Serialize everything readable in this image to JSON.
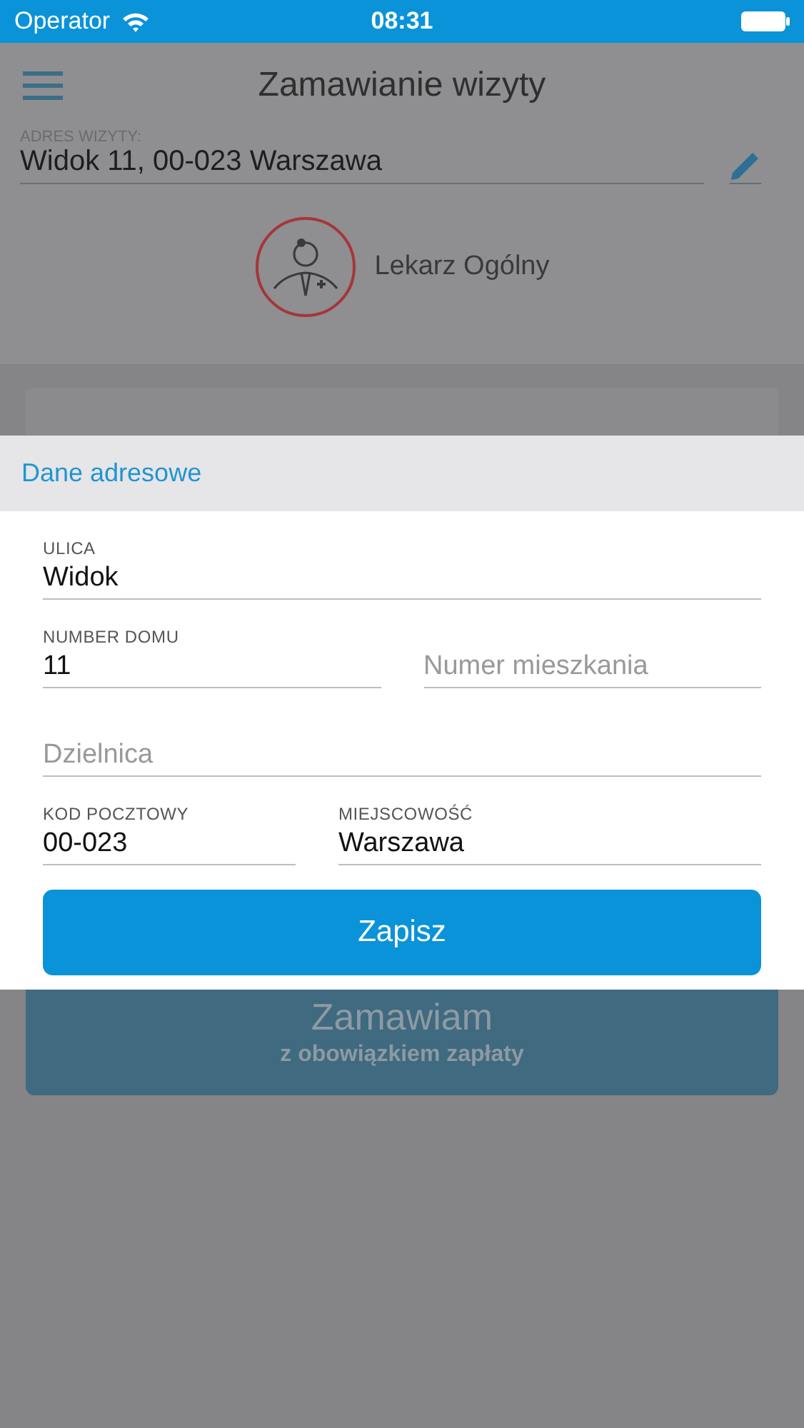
{
  "status_bar": {
    "carrier": "Operator",
    "time": "08:31"
  },
  "header": {
    "title": "Zamawianie wizyty"
  },
  "address": {
    "label": "ADRES WIZYTY:",
    "value": "Widok 11, 00-023 Warszawa"
  },
  "specialist": {
    "name": "Lekarz Ogólny"
  },
  "order_button": {
    "title": "Zamawiam",
    "subtitle": "z obowiązkiem zapłaty"
  },
  "sheet": {
    "title": "Dane adresowe",
    "rows": [
      [
        {
          "label": "ULICA",
          "value": "Widok"
        }
      ],
      [
        {
          "label": "NUMBER DOMU",
          "value": "11"
        },
        {
          "placeholder": "Numer mieszkania"
        }
      ],
      [
        {
          "placeholder": "Dzielnica"
        }
      ],
      [
        {
          "label": "KOD POCZTOWY",
          "value": "00-023"
        },
        {
          "label": "MIEJSCOWOŚĆ",
          "value": "Warszawa"
        }
      ]
    ],
    "button": "Zapisz"
  }
}
